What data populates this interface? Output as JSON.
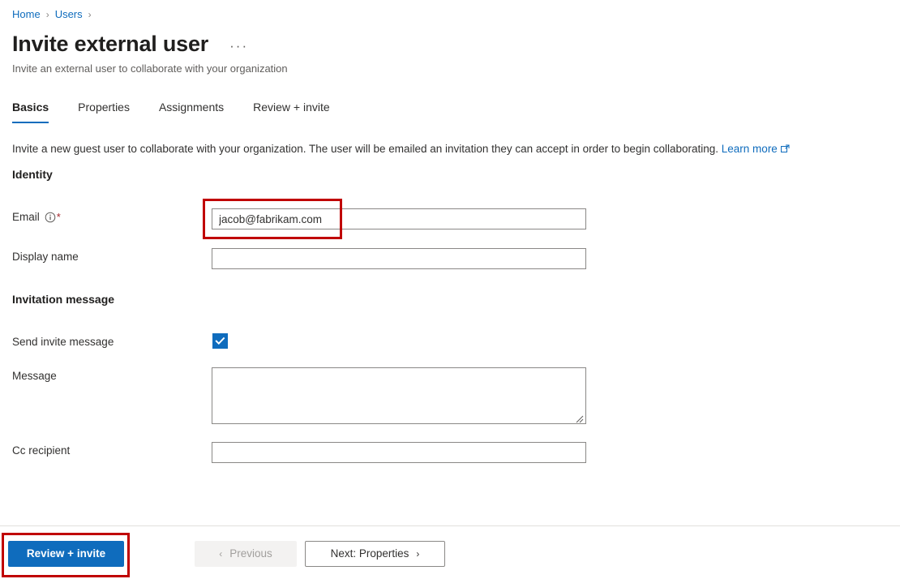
{
  "breadcrumb": {
    "items": [
      {
        "label": "Home"
      },
      {
        "label": "Users"
      }
    ],
    "separator": "›"
  },
  "header": {
    "title": "Invite external user",
    "more_label": "···",
    "subtitle": "Invite an external user to collaborate with your organization"
  },
  "tabs": [
    {
      "label": "Basics",
      "active": true
    },
    {
      "label": "Properties",
      "active": false
    },
    {
      "label": "Assignments",
      "active": false
    },
    {
      "label": "Review + invite",
      "active": false
    }
  ],
  "intro": {
    "text": "Invite a new guest user to collaborate with your organization. The user will be emailed an invitation they can accept in order to begin collaborating.",
    "link_label": "Learn more",
    "link_icon": "external-link-icon"
  },
  "sections": {
    "identity": {
      "heading": "Identity",
      "fields": {
        "email": {
          "label": "Email",
          "required_marker": "*",
          "info_icon": "info-circle-icon",
          "value": "jacob@fabrikam.com",
          "placeholder": ""
        },
        "display_name": {
          "label": "Display name",
          "value": "",
          "placeholder": ""
        }
      }
    },
    "invitation_message": {
      "heading": "Invitation message",
      "fields": {
        "send_invite_message": {
          "label": "Send invite message",
          "checked": true,
          "check_glyph": "✓"
        },
        "message": {
          "label": "Message",
          "value": "",
          "placeholder": ""
        },
        "cc_recipient": {
          "label": "Cc recipient",
          "value": "",
          "placeholder": ""
        }
      }
    }
  },
  "footer": {
    "review_button": "Review + invite",
    "previous_button": "Previous",
    "previous_chevron": "‹",
    "next_button": "Next: Properties",
    "next_chevron": "›"
  },
  "colors": {
    "accent": "#0f6cbd",
    "link": "#0f6cbd",
    "required": "#a4262c",
    "annotation": "#c00000",
    "border": "#8a8886",
    "disabled_bg": "#f3f2f1"
  }
}
